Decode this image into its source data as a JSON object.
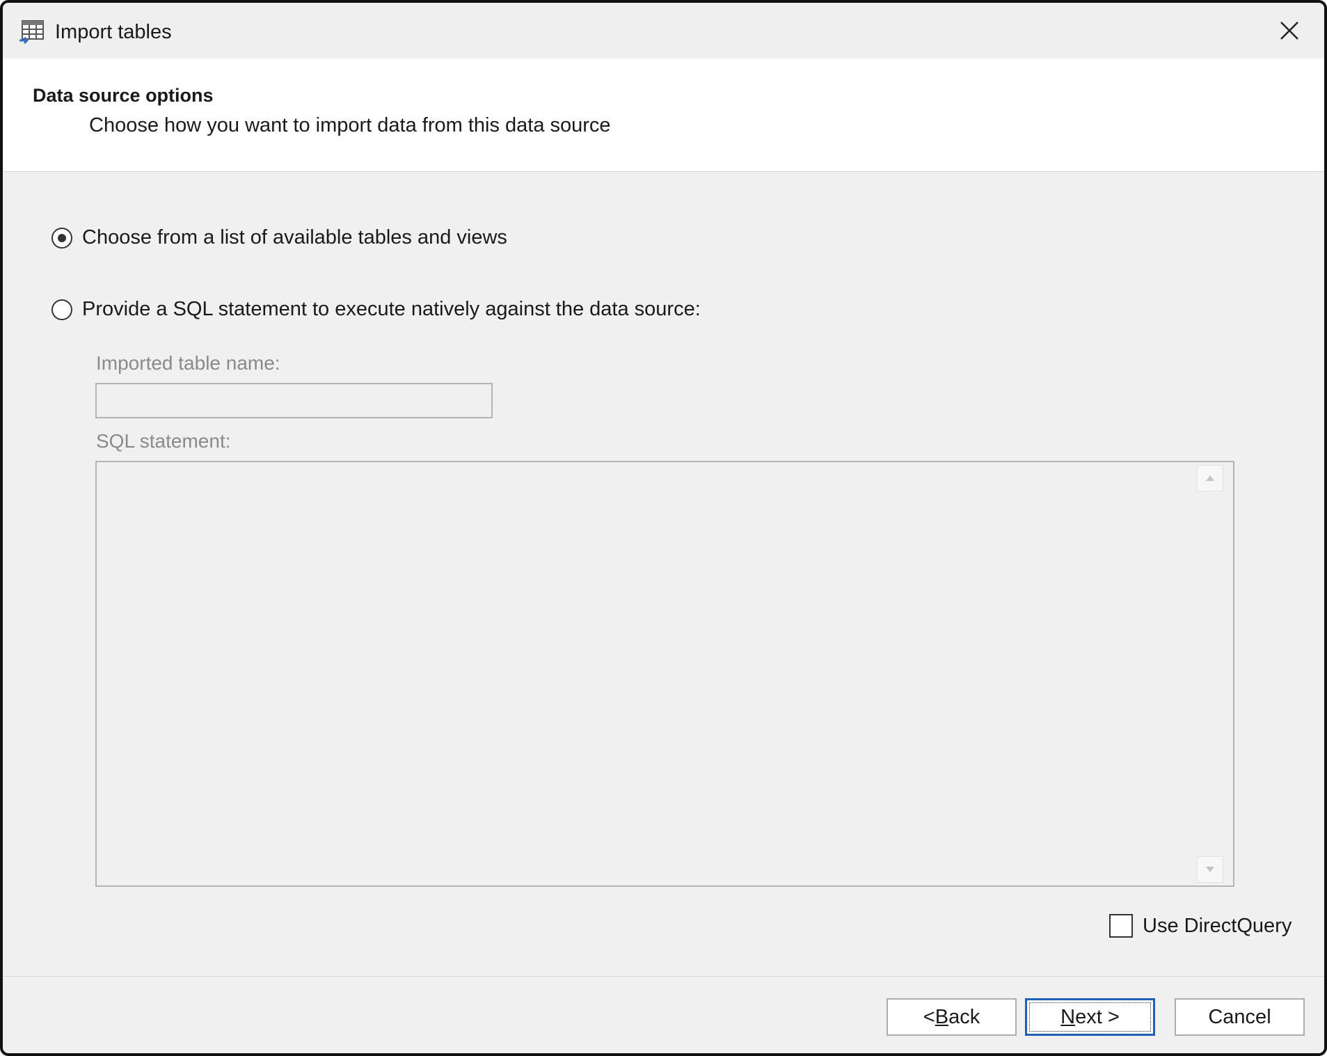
{
  "window": {
    "title": "Import tables"
  },
  "header": {
    "title": "Data source options",
    "subtitle": "Choose how you want to import data from this data source"
  },
  "options": [
    {
      "label": "Choose from a list of available tables and views",
      "selected": true
    },
    {
      "label": "Provide a SQL statement to execute natively against the data source:",
      "selected": false
    }
  ],
  "fields": {
    "table_name_label": "Imported table name:",
    "table_name_value": "",
    "sql_label": "SQL statement:",
    "sql_value": ""
  },
  "direct_query": {
    "label": "Use DirectQuery",
    "checked": false
  },
  "buttons": {
    "back_prefix": "< ",
    "back_mnemonic": "B",
    "back_rest": "ack",
    "next_mnemonic": "N",
    "next_rest": "ext >",
    "cancel": "Cancel"
  },
  "icons": {
    "app": "import-table-icon",
    "close": "close-icon",
    "scroll_up": "scroll-up-icon",
    "scroll_down": "scroll-down-icon"
  },
  "colors": {
    "accent": "#1f5fb8",
    "disabled_text": "#8a8a8a"
  }
}
